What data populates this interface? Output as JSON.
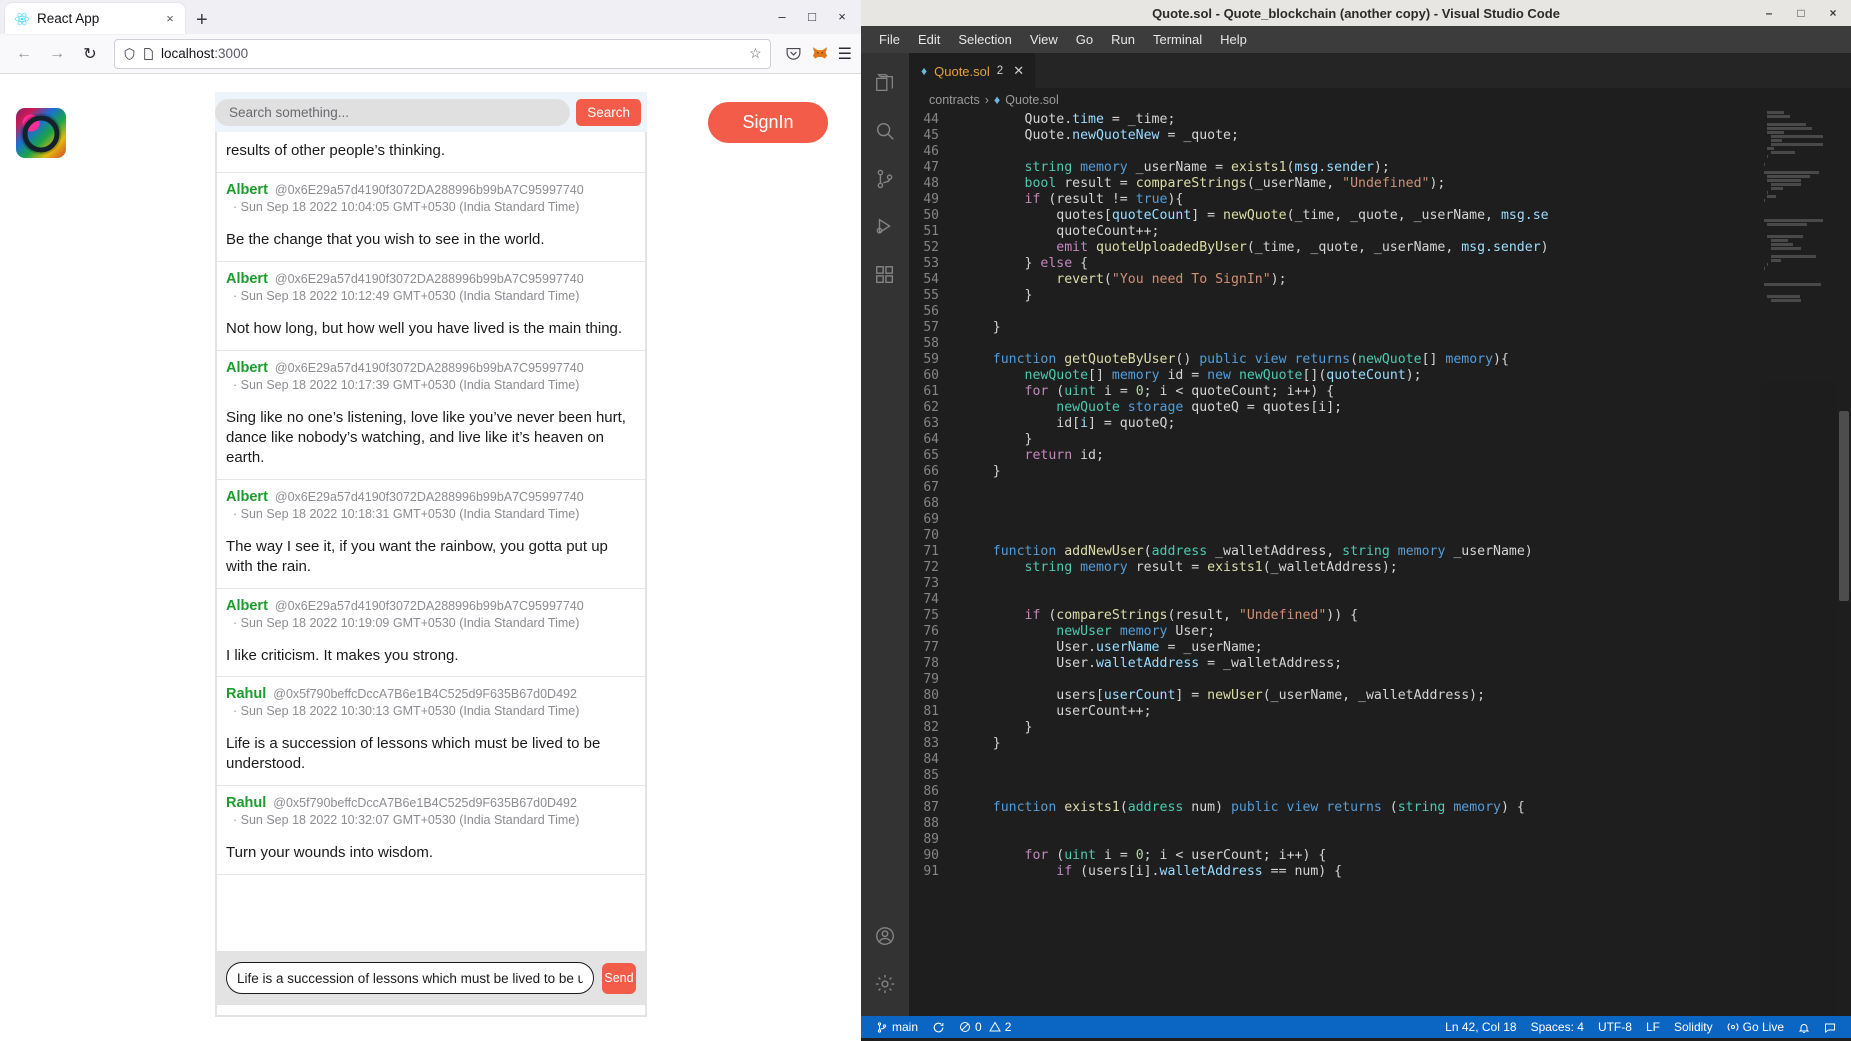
{
  "browser": {
    "tab": {
      "title": "React App",
      "favicon": "react-icon",
      "close": "×"
    },
    "newtab_label": "+",
    "window_buttons": {
      "minimize": "–",
      "maximize": "□",
      "close": "×"
    },
    "nav": {
      "back": "←",
      "forward": "→",
      "reload": "↻"
    },
    "url": {
      "scheme_icon": "shield-icon",
      "page_icon": "page-icon",
      "host": "localhost",
      "port": ":3000",
      "bookmark": "☆"
    },
    "toolbar_right": {
      "pocket": "pocket-icon",
      "extension": "metamask-fox-icon",
      "menu": "☰"
    }
  },
  "app": {
    "logo": "quote-app-logo",
    "search": {
      "placeholder": "Search something...",
      "value": "",
      "button_label": "Search"
    },
    "signin_label": "SignIn",
    "composer": {
      "value": "Life is a succession of lessons which must be lived to be understood.",
      "send_label": "Send"
    },
    "quotes": [
      {
        "clipped": true,
        "name": "",
        "address": "",
        "time": "",
        "text": "results of other people’s thinking."
      },
      {
        "clipped": false,
        "name": "Albert",
        "address": "@0x6E29a57d4190f3072DA288996b99bA7C95997740",
        "time": "· Sun Sep 18 2022 10:04:05 GMT+0530 (India Standard Time)",
        "text": "Be the change that you wish to see in the world."
      },
      {
        "clipped": false,
        "name": "Albert",
        "address": "@0x6E29a57d4190f3072DA288996b99bA7C95997740",
        "time": "· Sun Sep 18 2022 10:12:49 GMT+0530 (India Standard Time)",
        "text": "Not how long, but how well you have lived is the main thing."
      },
      {
        "clipped": false,
        "name": "Albert",
        "address": "@0x6E29a57d4190f3072DA288996b99bA7C95997740",
        "time": "· Sun Sep 18 2022 10:17:39 GMT+0530 (India Standard Time)",
        "text": "Sing like no one’s listening, love like you’ve never been hurt, dance like nobody’s watching, and live like it’s heaven on earth."
      },
      {
        "clipped": false,
        "name": "Albert",
        "address": "@0x6E29a57d4190f3072DA288996b99bA7C95997740",
        "time": "· Sun Sep 18 2022 10:18:31 GMT+0530 (India Standard Time)",
        "text": "The way I see it, if you want the rainbow, you gotta put up with the rain."
      },
      {
        "clipped": false,
        "name": "Albert",
        "address": "@0x6E29a57d4190f3072DA288996b99bA7C95997740",
        "time": "· Sun Sep 18 2022 10:19:09 GMT+0530 (India Standard Time)",
        "text": "I like criticism. It makes you strong."
      },
      {
        "clipped": false,
        "name": "Rahul",
        "address": "@0x5f790beffcDccA7B6e1B4C525d9F635B67d0D492",
        "time": "· Sun Sep 18 2022 10:30:13 GMT+0530 (India Standard Time)",
        "text": "Life is a succession of lessons which must be lived to be understood."
      },
      {
        "clipped": false,
        "name": "Rahul",
        "address": "@0x5f790beffcDccA7B6e1B4C525d9F635B67d0D492",
        "time": "· Sun Sep 18 2022 10:32:07 GMT+0530 (India Standard Time)",
        "text": "Turn your wounds into wisdom."
      }
    ]
  },
  "vscode": {
    "title": "Quote.sol - Quote_blockchain (another copy) - Visual Studio Code",
    "window_buttons": {
      "minimize": "–",
      "maximize": "□",
      "close": "×"
    },
    "menu": [
      "File",
      "Edit",
      "Selection",
      "View",
      "Go",
      "Run",
      "Terminal",
      "Help"
    ],
    "title_actions": {
      "split_editor": "split-editor-icon",
      "more": "⋯"
    },
    "activity_bar": [
      "explorer-icon",
      "search-icon",
      "source-control-icon",
      "run-debug-icon",
      "extensions-icon",
      "account-icon",
      "settings-gear-icon"
    ],
    "tab": {
      "label": "Quote.sol",
      "badge": "2",
      "close": "✕",
      "icon": "solidity-icon"
    },
    "breadcrumb": {
      "folder": "contracts",
      "separator": "›",
      "file": "Quote.sol"
    },
    "status_bar": {
      "branch": "main",
      "sync": "sync-icon",
      "errors": "0",
      "warnings": "2",
      "cursor": "Ln 42, Col 18",
      "spaces": "Spaces: 4",
      "encoding": "UTF-8",
      "eol": "LF",
      "language": "Solidity",
      "golive": "Go Live",
      "bell": "bell-icon",
      "feedback": "feedback-icon"
    },
    "code_lines": [
      {
        "n": 44,
        "tokens": [
          [
            "op",
            "        Quote."
          ],
          [
            "va",
            "time"
          ],
          [
            "op",
            " = _time;"
          ]
        ]
      },
      {
        "n": 45,
        "tokens": [
          [
            "op",
            "        Quote."
          ],
          [
            "va",
            "newQuoteNew"
          ],
          [
            "op",
            " = _quote;"
          ]
        ]
      },
      {
        "n": 46,
        "tokens": [
          [
            "op",
            ""
          ]
        ]
      },
      {
        "n": 47,
        "tokens": [
          [
            "ty",
            "        string"
          ],
          [
            "k",
            " memory"
          ],
          [
            "op",
            " _userName = "
          ],
          [
            "fn",
            "exists1"
          ],
          [
            "op",
            "("
          ],
          [
            "va",
            "msg.sender"
          ],
          [
            "op",
            ");"
          ]
        ]
      },
      {
        "n": 48,
        "tokens": [
          [
            "ty",
            "        bool"
          ],
          [
            "op",
            " result = "
          ],
          [
            "fn",
            "compareStrings"
          ],
          [
            "op",
            "(_userName, "
          ],
          [
            "st",
            "\"Undefined\""
          ],
          [
            "op",
            ");"
          ]
        ]
      },
      {
        "n": 49,
        "tokens": [
          [
            "kc",
            "        if"
          ],
          [
            "op",
            " (result != "
          ],
          [
            "k",
            "true"
          ],
          [
            "op",
            "){"
          ]
        ]
      },
      {
        "n": 50,
        "tokens": [
          [
            "op",
            "            quotes["
          ],
          [
            "va",
            "quoteCount"
          ],
          [
            "op",
            "] = "
          ],
          [
            "fn",
            "newQuote"
          ],
          [
            "op",
            "(_time, _quote, _userName, "
          ],
          [
            "va",
            "msg.se"
          ]
        ]
      },
      {
        "n": 51,
        "tokens": [
          [
            "op",
            "            quoteCount++;"
          ]
        ]
      },
      {
        "n": 52,
        "tokens": [
          [
            "kc",
            "            emit"
          ],
          [
            "op",
            " "
          ],
          [
            "fn",
            "quoteUploadedByUser"
          ],
          [
            "op",
            "(_time, _quote, _userName, "
          ],
          [
            "va",
            "msg.sender"
          ],
          [
            "op",
            ")"
          ]
        ]
      },
      {
        "n": 53,
        "tokens": [
          [
            "op",
            "        } "
          ],
          [
            "kc",
            "else"
          ],
          [
            "op",
            " {"
          ]
        ]
      },
      {
        "n": 54,
        "tokens": [
          [
            "op",
            "            "
          ],
          [
            "fn",
            "revert"
          ],
          [
            "op",
            "("
          ],
          [
            "st",
            "\"You need To SignIn\""
          ],
          [
            "op",
            ");"
          ]
        ]
      },
      {
        "n": 55,
        "tokens": [
          [
            "op",
            "        }"
          ]
        ]
      },
      {
        "n": 56,
        "tokens": [
          [
            "op",
            ""
          ]
        ]
      },
      {
        "n": 57,
        "tokens": [
          [
            "op",
            "    }"
          ]
        ]
      },
      {
        "n": 58,
        "tokens": [
          [
            "op",
            ""
          ]
        ]
      },
      {
        "n": 59,
        "tokens": [
          [
            "k",
            "    function"
          ],
          [
            "op",
            " "
          ],
          [
            "fn",
            "getQuoteByUser"
          ],
          [
            "op",
            "() "
          ],
          [
            "k",
            "public view returns"
          ],
          [
            "op",
            "("
          ],
          [
            "ty",
            "newQuote"
          ],
          [
            "op",
            "[] "
          ],
          [
            "k",
            "memory"
          ],
          [
            "op",
            "){"
          ]
        ]
      },
      {
        "n": 60,
        "tokens": [
          [
            "ty",
            "        newQuote"
          ],
          [
            "op",
            "[] "
          ],
          [
            "k",
            "memory"
          ],
          [
            "op",
            " id = "
          ],
          [
            "k",
            "new"
          ],
          [
            "op",
            " "
          ],
          [
            "ty",
            "newQuote"
          ],
          [
            "op",
            "[]("
          ],
          [
            "va",
            "quoteCount"
          ],
          [
            "op",
            ");"
          ]
        ]
      },
      {
        "n": 61,
        "tokens": [
          [
            "kc",
            "        for"
          ],
          [
            "op",
            " ("
          ],
          [
            "ty",
            "uint"
          ],
          [
            "op",
            " i = "
          ],
          [
            "nu",
            "0"
          ],
          [
            "op",
            "; i < quoteCount; i++) {"
          ]
        ]
      },
      {
        "n": 62,
        "tokens": [
          [
            "ty",
            "            newQuote"
          ],
          [
            "op",
            " "
          ],
          [
            "k",
            "storage"
          ],
          [
            "op",
            " quoteQ = quotes[i];"
          ]
        ]
      },
      {
        "n": 63,
        "tokens": [
          [
            "op",
            "            id["
          ],
          [
            "va",
            "i"
          ],
          [
            "op",
            "] = quoteQ;"
          ]
        ]
      },
      {
        "n": 64,
        "tokens": [
          [
            "op",
            "        }"
          ]
        ]
      },
      {
        "n": 65,
        "tokens": [
          [
            "kc",
            "        return"
          ],
          [
            "op",
            " id;"
          ]
        ]
      },
      {
        "n": 66,
        "tokens": [
          [
            "op",
            "    }"
          ]
        ]
      },
      {
        "n": 67,
        "tokens": [
          [
            "op",
            ""
          ]
        ]
      },
      {
        "n": 68,
        "tokens": [
          [
            "op",
            ""
          ]
        ]
      },
      {
        "n": 69,
        "tokens": [
          [
            "op",
            ""
          ]
        ]
      },
      {
        "n": 70,
        "tokens": [
          [
            "op",
            ""
          ]
        ]
      },
      {
        "n": 71,
        "tokens": [
          [
            "k",
            "    function"
          ],
          [
            "op",
            " "
          ],
          [
            "fn",
            "addNewUser"
          ],
          [
            "op",
            "("
          ],
          [
            "ty",
            "address"
          ],
          [
            "op",
            " _walletAddress, "
          ],
          [
            "ty",
            "string"
          ],
          [
            "op",
            " "
          ],
          [
            "k",
            "memory"
          ],
          [
            "op",
            " _userName) "
          ]
        ]
      },
      {
        "n": 72,
        "tokens": [
          [
            "ty",
            "        string"
          ],
          [
            "op",
            " "
          ],
          [
            "k",
            "memory"
          ],
          [
            "op",
            " result = "
          ],
          [
            "fn",
            "exists1"
          ],
          [
            "op",
            "(_walletAddress);"
          ]
        ]
      },
      {
        "n": 73,
        "tokens": [
          [
            "op",
            ""
          ]
        ]
      },
      {
        "n": 74,
        "tokens": [
          [
            "op",
            ""
          ]
        ]
      },
      {
        "n": 75,
        "tokens": [
          [
            "kc",
            "        if"
          ],
          [
            "op",
            " ("
          ],
          [
            "fn",
            "compareStrings"
          ],
          [
            "op",
            "(result, "
          ],
          [
            "st",
            "\"Undefined\""
          ],
          [
            "op",
            ")) {"
          ]
        ]
      },
      {
        "n": 76,
        "tokens": [
          [
            "ty",
            "            newUser"
          ],
          [
            "op",
            " "
          ],
          [
            "k",
            "memory"
          ],
          [
            "op",
            " User;"
          ]
        ]
      },
      {
        "n": 77,
        "tokens": [
          [
            "op",
            "            User."
          ],
          [
            "va",
            "userName"
          ],
          [
            "op",
            " = _userName;"
          ]
        ]
      },
      {
        "n": 78,
        "tokens": [
          [
            "op",
            "            User."
          ],
          [
            "va",
            "walletAddress"
          ],
          [
            "op",
            " = _walletAddress;"
          ]
        ]
      },
      {
        "n": 79,
        "tokens": [
          [
            "op",
            ""
          ]
        ]
      },
      {
        "n": 80,
        "tokens": [
          [
            "op",
            "            users["
          ],
          [
            "va",
            "userCount"
          ],
          [
            "op",
            "] = "
          ],
          [
            "fn",
            "newUser"
          ],
          [
            "op",
            "(_userName, _walletAddress);"
          ]
        ]
      },
      {
        "n": 81,
        "tokens": [
          [
            "op",
            "            userCount++;"
          ]
        ]
      },
      {
        "n": 82,
        "tokens": [
          [
            "op",
            "        }"
          ]
        ]
      },
      {
        "n": 83,
        "tokens": [
          [
            "op",
            "    }"
          ]
        ]
      },
      {
        "n": 84,
        "tokens": [
          [
            "op",
            ""
          ]
        ]
      },
      {
        "n": 85,
        "tokens": [
          [
            "op",
            ""
          ]
        ]
      },
      {
        "n": 86,
        "tokens": [
          [
            "op",
            ""
          ]
        ]
      },
      {
        "n": 87,
        "tokens": [
          [
            "k",
            "    function"
          ],
          [
            "op",
            " "
          ],
          [
            "fn",
            "exists1"
          ],
          [
            "op",
            "("
          ],
          [
            "ty",
            "address"
          ],
          [
            "op",
            " num) "
          ],
          [
            "k",
            "public view returns"
          ],
          [
            "op",
            " ("
          ],
          [
            "ty",
            "string"
          ],
          [
            "op",
            " "
          ],
          [
            "k",
            "memory"
          ],
          [
            "op",
            ") {"
          ]
        ]
      },
      {
        "n": 88,
        "tokens": [
          [
            "op",
            ""
          ]
        ]
      },
      {
        "n": 89,
        "tokens": [
          [
            "op",
            ""
          ]
        ]
      },
      {
        "n": 90,
        "tokens": [
          [
            "kc",
            "        for"
          ],
          [
            "op",
            " ("
          ],
          [
            "ty",
            "uint"
          ],
          [
            "op",
            " i = "
          ],
          [
            "nu",
            "0"
          ],
          [
            "op",
            "; i < userCount; i++) {"
          ]
        ]
      },
      {
        "n": 91,
        "tokens": [
          [
            "kc",
            "            if"
          ],
          [
            "op",
            " (users[i]."
          ],
          [
            "va",
            "walletAddress"
          ],
          [
            "op",
            " == num) {"
          ]
        ]
      }
    ]
  }
}
